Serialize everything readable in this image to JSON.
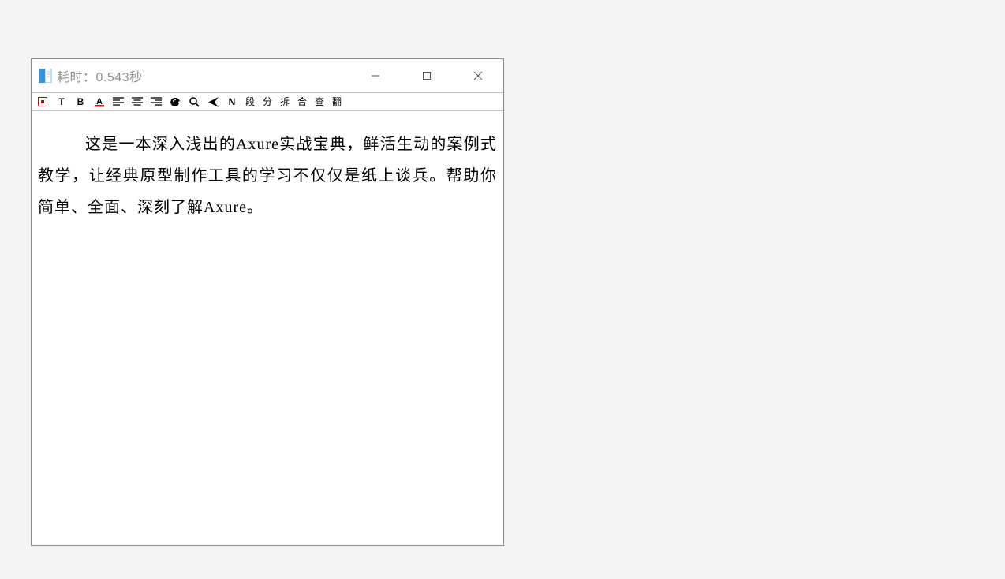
{
  "window": {
    "title": "耗时：0.543秒"
  },
  "toolbar": {
    "items": [
      {
        "name": "stop-icon",
        "label": "▣"
      },
      {
        "name": "text-tool-button",
        "label": "T"
      },
      {
        "name": "bold-button",
        "label": "B"
      },
      {
        "name": "font-color-button",
        "label": "A"
      },
      {
        "name": "align-left-button",
        "label": "≡"
      },
      {
        "name": "align-center-button",
        "label": "≡"
      },
      {
        "name": "align-right-button",
        "label": "≡"
      },
      {
        "name": "palette-icon",
        "label": "◐"
      },
      {
        "name": "search-icon",
        "label": "🔍"
      },
      {
        "name": "send-icon",
        "label": "➤"
      },
      {
        "name": "normal-button",
        "label": "N"
      },
      {
        "name": "paragraph-button",
        "label": "段"
      },
      {
        "name": "split-button",
        "label": "分"
      },
      {
        "name": "tear-button",
        "label": "拆"
      },
      {
        "name": "merge-button",
        "label": "合"
      },
      {
        "name": "check-button",
        "label": "查"
      },
      {
        "name": "translate-button",
        "label": "翻"
      }
    ]
  },
  "content": {
    "paragraph": "这是一本深入浅出的Axure实战宝典，鲜活生动的案例式教学，让经典原型制作工具的学习不仅仅是纸上谈兵。帮助你简单、全面、深刻了解Axure。"
  }
}
